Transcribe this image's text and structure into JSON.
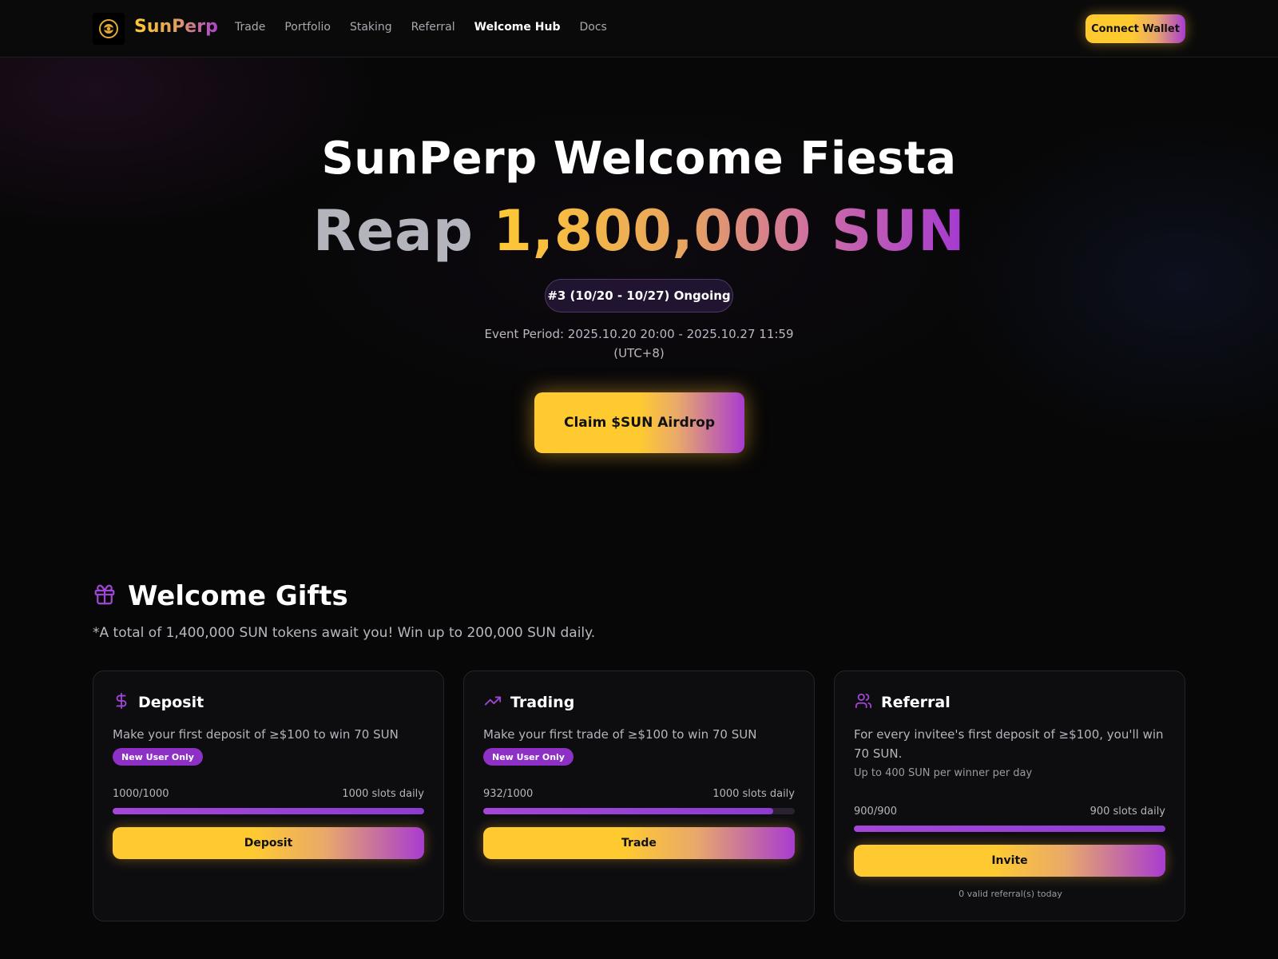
{
  "header": {
    "brand": "SunPerp",
    "nav": [
      {
        "label": "Trade",
        "active": false
      },
      {
        "label": "Portfolio",
        "active": false
      },
      {
        "label": "Staking",
        "active": false
      },
      {
        "label": "Referral",
        "active": false
      },
      {
        "label": "Welcome Hub",
        "active": true
      },
      {
        "label": "Docs",
        "active": false
      }
    ],
    "connect_label": "Connect Wallet"
  },
  "hero": {
    "title": "SunPerp Welcome Fiesta",
    "reap_word": "Reap",
    "amount": "1,800,000 SUN",
    "round_pill": "#3 (10/20 - 10/27) Ongoing",
    "event_period_line1": "Event Period: 2025.10.20 20:00 - 2025.10.27 11:59",
    "event_period_line2": "(UTC+8)",
    "claim_label": "Claim $SUN Airdrop"
  },
  "gifts": {
    "heading": "Welcome Gifts",
    "subtitle": "*A total of 1,400,000 SUN tokens await you! Win up to 200,000 SUN daily.",
    "cards": [
      {
        "icon": "dollar-icon",
        "title": "Deposit",
        "desc": "Make your first deposit of ≥$100 to win 70 SUN",
        "badge": "New User Only",
        "progress_text": "1000/1000",
        "slots_text": "1000 slots daily",
        "progress": 1.0,
        "button": "Deposit"
      },
      {
        "icon": "trending-up-icon",
        "title": "Trading",
        "desc": "Make your first trade of ≥$100 to win 70 SUN",
        "badge": "New User Only",
        "progress_text": "932/1000",
        "slots_text": "1000 slots daily",
        "progress": 0.932,
        "button": "Trade"
      },
      {
        "icon": "users-icon",
        "title": "Referral",
        "desc": "For every invitee's first deposit of ≥$100, you'll win 70 SUN.",
        "note": "Up to 400 SUN per winner per day",
        "progress_text": "900/900",
        "slots_text": "900 slots daily",
        "progress": 1.0,
        "button": "Invite",
        "footer": "0 valid referral(s) today"
      }
    ]
  },
  "colors": {
    "accent_yellow": "#ffca30",
    "accent_purple": "#a83cd0",
    "background": "#070707"
  }
}
